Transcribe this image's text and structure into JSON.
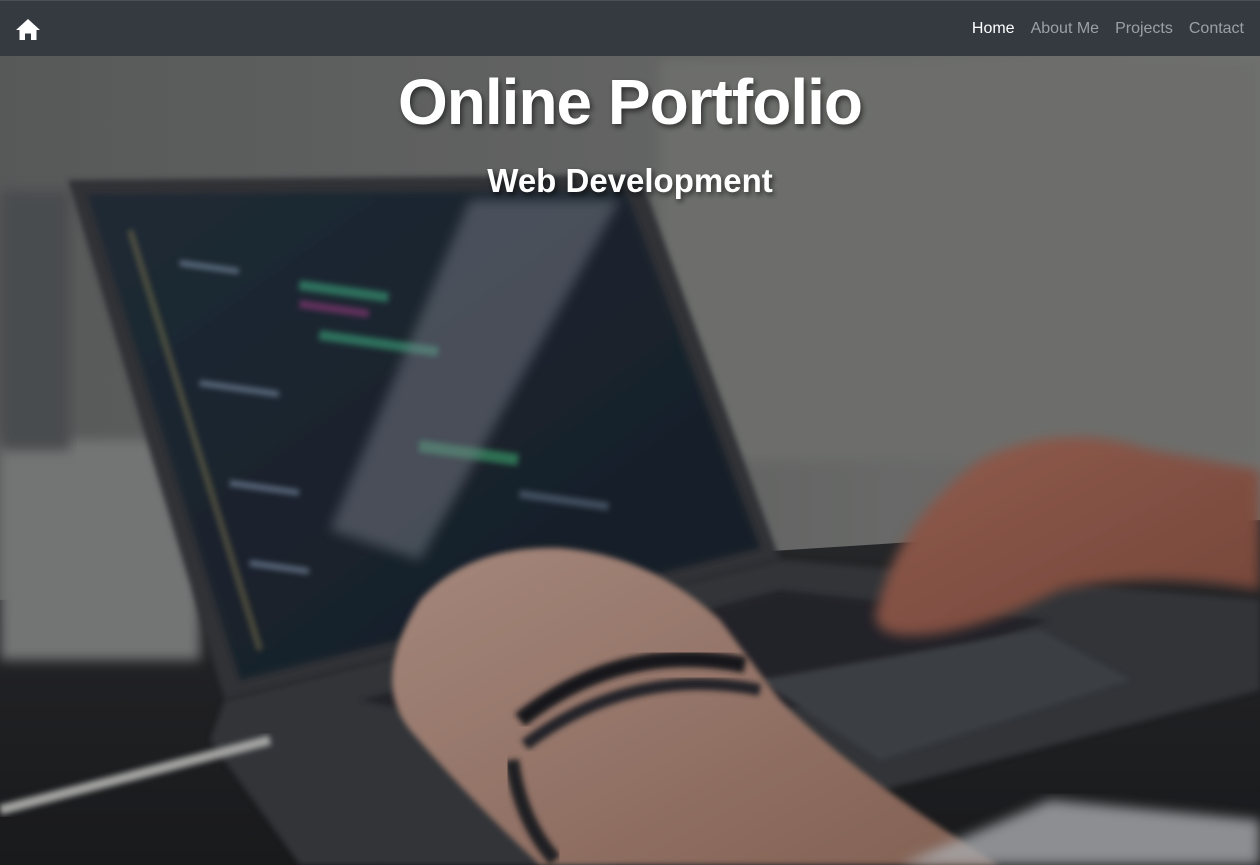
{
  "navbar": {
    "home_icon": "home-icon",
    "links": [
      {
        "label": "Home",
        "active": true
      },
      {
        "label": "About Me",
        "active": false
      },
      {
        "label": "Projects",
        "active": false
      },
      {
        "label": "Contact",
        "active": false
      }
    ]
  },
  "hero": {
    "title": "Online Portfolio",
    "subtitle": "Web Development",
    "background_image": "laptop-coding-hands-photo"
  },
  "colors": {
    "navbar_bg": "#343a40",
    "nav_link_active": "#ffffff",
    "nav_link_inactive": "#9aa0a6",
    "title_text": "#ffffff"
  }
}
